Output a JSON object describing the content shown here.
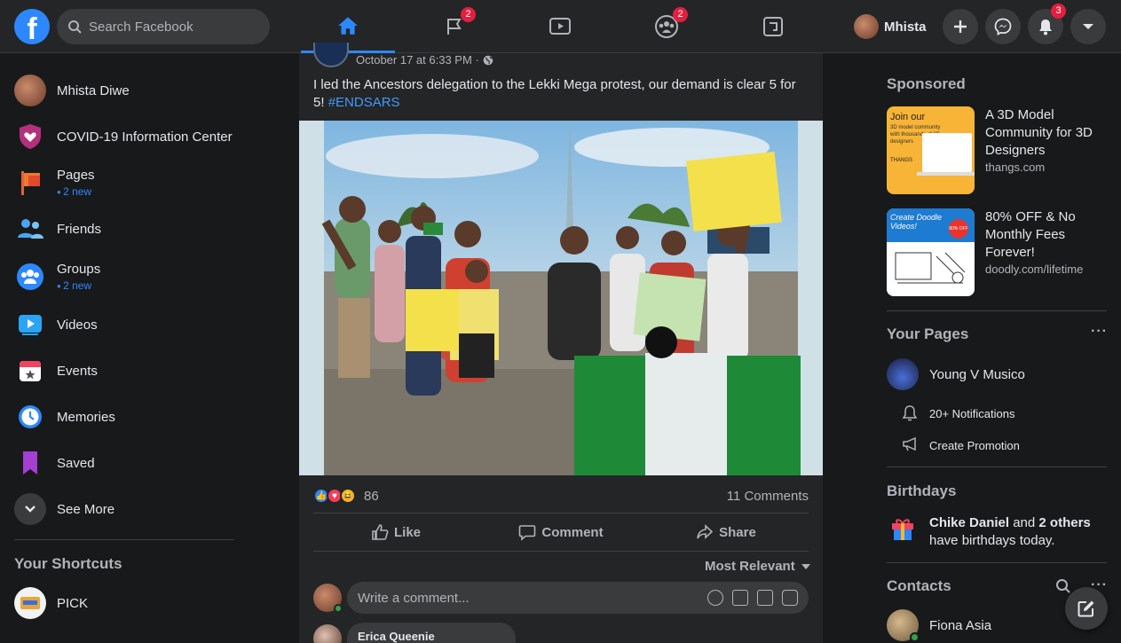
{
  "header": {
    "logo": "f",
    "search_placeholder": "Search Facebook",
    "tabs": [
      {
        "name": "home",
        "badge": ""
      },
      {
        "name": "pages",
        "badge": "2"
      },
      {
        "name": "watch",
        "badge": ""
      },
      {
        "name": "groups",
        "badge": "2"
      },
      {
        "name": "gaming",
        "badge": ""
      }
    ],
    "profile_name": "Mhista",
    "notifications_badge": "3"
  },
  "sidebar": {
    "items": [
      {
        "label": "Mhista Diwe",
        "sub": ""
      },
      {
        "label": "COVID-19 Information Center",
        "sub": ""
      },
      {
        "label": "Pages",
        "sub": "2 new"
      },
      {
        "label": "Friends",
        "sub": ""
      },
      {
        "label": "Groups",
        "sub": "2 new"
      },
      {
        "label": "Videos",
        "sub": ""
      },
      {
        "label": "Events",
        "sub": ""
      },
      {
        "label": "Memories",
        "sub": ""
      },
      {
        "label": "Saved",
        "sub": ""
      },
      {
        "label": "See More",
        "sub": ""
      }
    ],
    "shortcuts_title": "Your Shortcuts",
    "shortcuts": [
      {
        "label": "PICK"
      }
    ]
  },
  "post": {
    "timestamp": "October 17 at 6:33 PM ·",
    "text": "I led the Ancestors delegation to the Lekki Mega protest, our demand is clear 5 for 5!",
    "hashtag": "#ENDSARS",
    "reaction_count": "86",
    "comments_count": "11 Comments",
    "actions": {
      "like": "Like",
      "comment": "Comment",
      "share": "Share"
    },
    "sort_label": "Most Relevant",
    "comment_placeholder": "Write a comment...",
    "next_commenter": "Erica Queenie"
  },
  "right": {
    "sponsored_title": "Sponsored",
    "ads": [
      {
        "title": "A 3D Model Community for 3D Designers",
        "domain": "thangs.com",
        "img_text": "Join our",
        "img_sub": "3D model community with thousands of 3D designers",
        "img_brand": "THANGS"
      },
      {
        "title": "80% OFF & No Monthly Fees Forever!",
        "domain": "doodly.com/lifetime",
        "img_text": "Create Doodle Videos!",
        "img_badge": "80% OFF"
      }
    ],
    "pages_title": "Your Pages",
    "page_name": "Young V Musico",
    "page_notifications": "20+ Notifications",
    "page_promotion": "Create Promotion",
    "birthdays_title": "Birthdays",
    "birthday_names": "Chike Daniel",
    "birthday_and": "and",
    "birthday_others": "2 others",
    "birthday_rest": "have birthdays today.",
    "contacts_title": "Contacts",
    "contacts": [
      {
        "name": "Fiona Asia"
      }
    ]
  },
  "colors": {
    "accent": "#2d88ff",
    "badge": "#e41e3f",
    "background": "#18191a",
    "surface": "#242526"
  }
}
